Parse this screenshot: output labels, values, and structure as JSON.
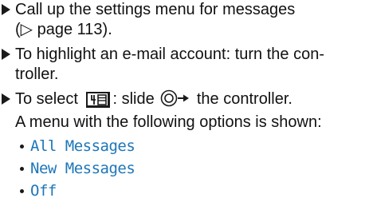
{
  "steps": [
    {
      "line1": "Call up the settings menu for messages",
      "line2": "(▷ page 113)."
    },
    {
      "line1": "To highlight an e-mail account: turn the con-",
      "line2": "troller."
    },
    {
      "prefix": "To select",
      "button_icon": "menu-list-icon",
      "middle": ": slide",
      "controller_icon": "controller-slide-right-icon",
      "suffix": "the controller.",
      "line2": "A menu with the following options is shown:"
    }
  ],
  "options": [
    "All Messages",
    "New Messages",
    "Off"
  ],
  "colors": {
    "text": "#111111",
    "option": "#1d76b8"
  }
}
